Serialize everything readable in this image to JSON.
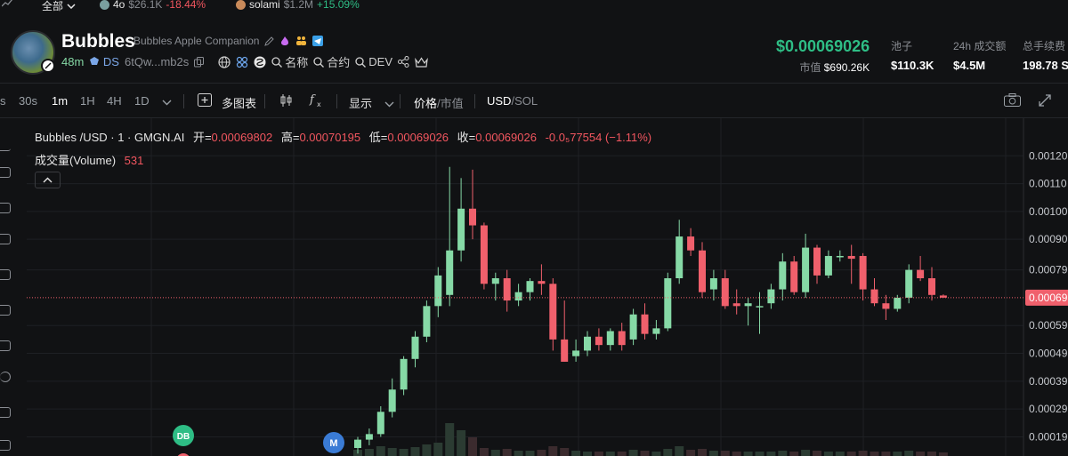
{
  "ticker": {
    "filter_label": "全部",
    "items": [
      {
        "symbol": "4o",
        "mcap": "$26.1K",
        "change": "-18.44%",
        "dir": "down",
        "dot": "#7aa0a0"
      },
      {
        "symbol": "solami",
        "mcap": "$1.2M",
        "change": "+15.09%",
        "dir": "up",
        "dot": "#c98a5a"
      }
    ]
  },
  "token": {
    "name": "Bubbles",
    "full_name": "Bubbles Apple Companion",
    "age": "48m",
    "ds_label": "DS",
    "address": "6tQw...mb2s",
    "search_name": "名称",
    "search_contract": "合约",
    "search_dev": "DEV"
  },
  "market": {
    "price": "$0.00069026",
    "mcap_label": "市值",
    "mcap_value": "$690.26K",
    "pool_label": "池子",
    "pool_value": "$110.3K",
    "vol24_label": "24h 成交额",
    "vol24_value": "$4.5M",
    "fee_label": "总手续费",
    "fee_value": "198.78 S"
  },
  "toolbar": {
    "s_label": "s",
    "intervals": [
      "30s",
      "1m",
      "1H",
      "4H",
      "1D"
    ],
    "active_interval": "1m",
    "multi_chart": "多图表",
    "display": "显示",
    "price_label": "价格",
    "mcap_label": "市值",
    "currency_usd": "USD",
    "currency_sol": "SOL"
  },
  "legend": {
    "symbol": "Bubbles /USD · 1 · GMGN.AI",
    "open_label": "开=",
    "open": "0.00069802",
    "high_label": "高=",
    "high": "0.00070195",
    "low_label": "低=",
    "low": "0.00069026",
    "close_label": "收=",
    "close": "0.00069026",
    "change": "-0.0₅77554 (−1.11%)",
    "volume_label": "成交量(Volume)",
    "volume_value": "531"
  },
  "markers": {
    "db": "DB",
    "m": "M"
  },
  "colors": {
    "up": "#86d9a6",
    "down": "#f0606c",
    "background": "#111214",
    "accent_green": "#2ebd85"
  },
  "chart_data": {
    "type": "candlestick",
    "price_axis_ticks": [
      "0.00120",
      "0.00110",
      "0.00100",
      "0.00090",
      "0.00079",
      "0.00059",
      "0.00049",
      "0.00039",
      "0.00029",
      "0.00019"
    ],
    "current_price_label": "0.00069",
    "ylim": [
      0.00015,
      0.00122
    ],
    "candles": [
      {
        "o": 0.00015,
        "h": 0.00019,
        "l": 0.00013,
        "c": 0.00018
      },
      {
        "o": 0.00018,
        "h": 0.00022,
        "l": 0.00016,
        "c": 0.0002
      },
      {
        "o": 0.0002,
        "h": 0.0003,
        "l": 0.00019,
        "c": 0.00028
      },
      {
        "o": 0.00028,
        "h": 0.0004,
        "l": 0.00026,
        "c": 0.00036
      },
      {
        "o": 0.00036,
        "h": 0.00048,
        "l": 0.00034,
        "c": 0.00047
      },
      {
        "o": 0.00047,
        "h": 0.00057,
        "l": 0.00044,
        "c": 0.00055
      },
      {
        "o": 0.00055,
        "h": 0.00068,
        "l": 0.00053,
        "c": 0.00066
      },
      {
        "o": 0.00066,
        "h": 0.0008,
        "l": 0.00062,
        "c": 0.00077
      },
      {
        "o": 0.0007,
        "h": 0.00116,
        "l": 0.00066,
        "c": 0.00086
      },
      {
        "o": 0.00086,
        "h": 0.00112,
        "l": 0.00082,
        "c": 0.00101
      },
      {
        "o": 0.00101,
        "h": 0.00115,
        "l": 0.0009,
        "c": 0.00095
      },
      {
        "o": 0.00095,
        "h": 0.00096,
        "l": 0.00072,
        "c": 0.00074
      },
      {
        "o": 0.00074,
        "h": 0.00078,
        "l": 0.00068,
        "c": 0.00076
      },
      {
        "o": 0.00076,
        "h": 0.00079,
        "l": 0.00064,
        "c": 0.00068
      },
      {
        "o": 0.00068,
        "h": 0.00074,
        "l": 0.00066,
        "c": 0.00071
      },
      {
        "o": 0.00071,
        "h": 0.00076,
        "l": 0.00068,
        "c": 0.00075
      },
      {
        "o": 0.00075,
        "h": 0.00081,
        "l": 0.0007,
        "c": 0.00074
      },
      {
        "o": 0.00074,
        "h": 0.00076,
        "l": 0.0005,
        "c": 0.00054
      },
      {
        "o": 0.00054,
        "h": 0.00068,
        "l": 0.00046,
        "c": 0.00046
      },
      {
        "o": 0.00048,
        "h": 0.00054,
        "l": 0.00046,
        "c": 0.0005
      },
      {
        "o": 0.0005,
        "h": 0.00057,
        "l": 0.00048,
        "c": 0.00055
      },
      {
        "o": 0.00055,
        "h": 0.00058,
        "l": 0.0005,
        "c": 0.00052
      },
      {
        "o": 0.00052,
        "h": 0.00058,
        "l": 0.0005,
        "c": 0.00057
      },
      {
        "o": 0.00057,
        "h": 0.0006,
        "l": 0.0005,
        "c": 0.00052
      },
      {
        "o": 0.00054,
        "h": 0.00065,
        "l": 0.00052,
        "c": 0.00063
      },
      {
        "o": 0.00063,
        "h": 0.00067,
        "l": 0.00054,
        "c": 0.00056
      },
      {
        "o": 0.00056,
        "h": 0.00061,
        "l": 0.00054,
        "c": 0.00058
      },
      {
        "o": 0.00058,
        "h": 0.00078,
        "l": 0.00057,
        "c": 0.00076
      },
      {
        "o": 0.00076,
        "h": 0.00097,
        "l": 0.00074,
        "c": 0.00091
      },
      {
        "o": 0.00091,
        "h": 0.00094,
        "l": 0.00084,
        "c": 0.00086
      },
      {
        "o": 0.00086,
        "h": 0.00089,
        "l": 0.00069,
        "c": 0.00071
      },
      {
        "o": 0.00072,
        "h": 0.00079,
        "l": 0.00068,
        "c": 0.00076
      },
      {
        "o": 0.00076,
        "h": 0.00079,
        "l": 0.00065,
        "c": 0.00066
      },
      {
        "o": 0.00067,
        "h": 0.00072,
        "l": 0.00063,
        "c": 0.00066
      },
      {
        "o": 0.00066,
        "h": 0.00069,
        "l": 0.00059,
        "c": 0.00067
      },
      {
        "o": 0.00066,
        "h": 0.00071,
        "l": 0.00056,
        "c": 0.00066
      },
      {
        "o": 0.00067,
        "h": 0.00074,
        "l": 0.00065,
        "c": 0.00072
      },
      {
        "o": 0.00072,
        "h": 0.00085,
        "l": 0.00068,
        "c": 0.00082
      },
      {
        "o": 0.00082,
        "h": 0.00084,
        "l": 0.0007,
        "c": 0.00071
      },
      {
        "o": 0.00071,
        "h": 0.00092,
        "l": 0.00069,
        "c": 0.00087
      },
      {
        "o": 0.00087,
        "h": 0.00088,
        "l": 0.00074,
        "c": 0.00077
      },
      {
        "o": 0.00077,
        "h": 0.00086,
        "l": 0.00076,
        "c": 0.00084
      },
      {
        "o": 0.00084,
        "h": 0.00086,
        "l": 0.00082,
        "c": 0.00084
      },
      {
        "o": 0.00084,
        "h": 0.00088,
        "l": 0.00074,
        "c": 0.00083
      },
      {
        "o": 0.00084,
        "h": 0.00085,
        "l": 0.00068,
        "c": 0.00072
      },
      {
        "o": 0.00072,
        "h": 0.00076,
        "l": 0.00066,
        "c": 0.00067
      },
      {
        "o": 0.00067,
        "h": 0.0007,
        "l": 0.00061,
        "c": 0.00065
      },
      {
        "o": 0.00065,
        "h": 0.0007,
        "l": 0.00064,
        "c": 0.00069
      },
      {
        "o": 0.00069,
        "h": 0.00081,
        "l": 0.00067,
        "c": 0.00079
      },
      {
        "o": 0.00079,
        "h": 0.00084,
        "l": 0.00075,
        "c": 0.00076
      },
      {
        "o": 0.00076,
        "h": 0.0008,
        "l": 0.00068,
        "c": 0.0007
      },
      {
        "o": 0.00069802,
        "h": 0.00070195,
        "l": 0.00069026,
        "c": 0.00069026
      }
    ],
    "volume": [
      8,
      9,
      12,
      10,
      9,
      11,
      14,
      16,
      38,
      30,
      22,
      10,
      8,
      9,
      7,
      7,
      8,
      12,
      10,
      7,
      6,
      6,
      6,
      6,
      8,
      7,
      6,
      9,
      12,
      8,
      9,
      7,
      7,
      6,
      6,
      6,
      6,
      7,
      6,
      8,
      7,
      6,
      6,
      6,
      7,
      6,
      6,
      6,
      7,
      6,
      6,
      5
    ]
  }
}
